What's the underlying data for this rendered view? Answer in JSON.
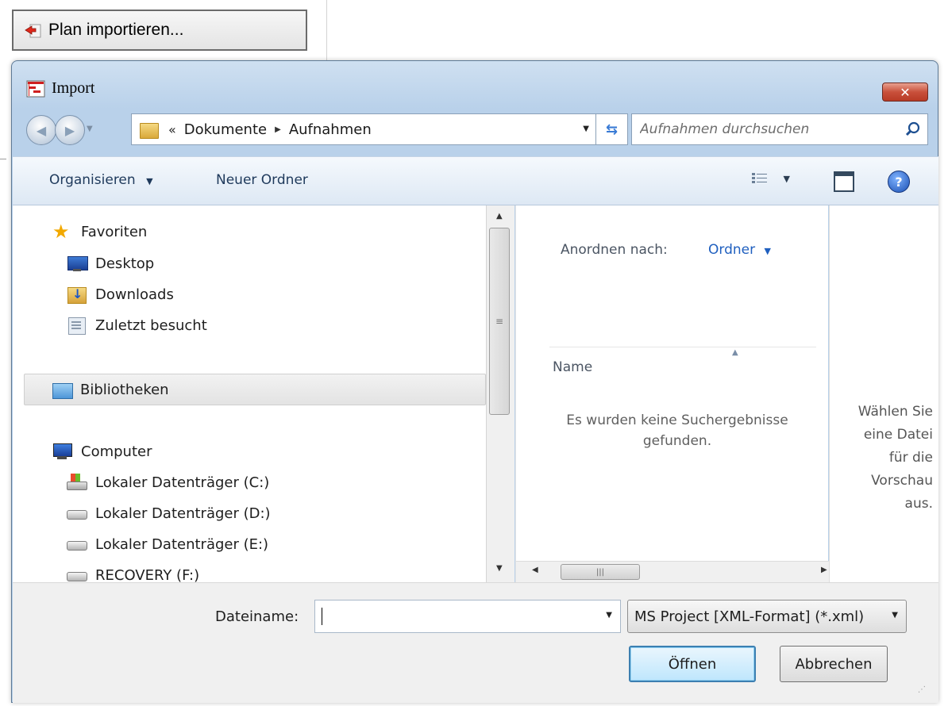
{
  "background_app": {
    "plan_import_button": "Plan importieren..."
  },
  "dialog": {
    "title": "Import",
    "close_glyph": "✕"
  },
  "navigation": {
    "address": {
      "chevron": "«",
      "segments": [
        "Dokumente",
        "Aufnahmen"
      ]
    },
    "search_placeholder": "Aufnahmen durchsuchen"
  },
  "toolbar": {
    "organize_label": "Organisieren",
    "new_folder_label": "Neuer Ordner",
    "help_glyph": "?"
  },
  "nav_pane": {
    "favorites": {
      "label": "Favoriten",
      "items": [
        "Desktop",
        "Downloads",
        "Zuletzt besucht"
      ]
    },
    "libraries_label": "Bibliotheken",
    "computer": {
      "label": "Computer",
      "drives": [
        "Lokaler Datenträger (C:)",
        "Lokaler Datenträger (D:)",
        "Lokaler Datenträger (E:)",
        "RECOVERY (F:)"
      ]
    }
  },
  "content_pane": {
    "sort_label": "Anordnen nach:",
    "sort_value": "Ordner",
    "column_name": "Name",
    "no_results": "Es wurden keine Suchergebnisse gefunden."
  },
  "preview_pane": {
    "lines": [
      "Wählen Sie",
      "eine Datei",
      "für die",
      "Vorschau",
      "aus."
    ]
  },
  "bottom": {
    "filename_label": "Dateiname:",
    "filename_value": "",
    "filetype_value": "MS Project [XML-Format] (*.xml)",
    "open_label": "Öffnen",
    "cancel_label": "Abbrechen"
  },
  "colors": {
    "accent_link": "#1f5fbf",
    "toolbar_text": "#1e395b",
    "close_button": "#c9503b"
  }
}
